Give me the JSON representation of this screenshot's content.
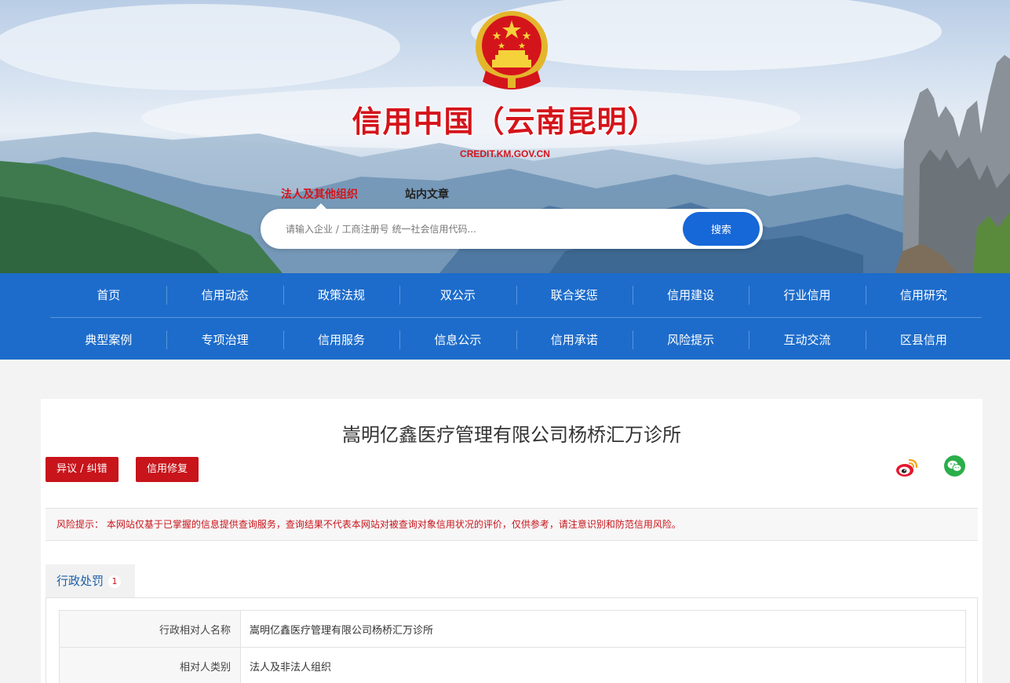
{
  "header": {
    "site_title": "信用中国（云南昆明）",
    "site_domain": "CREDIT.KM.GOV.CN",
    "search_tabs": [
      {
        "label": "法人及其他组织",
        "active": true
      },
      {
        "label": "站内文章",
        "active": false
      }
    ],
    "search_placeholder": "请输入企业 / 工商注册号 统一社会信用代码...",
    "search_button": "搜索"
  },
  "nav": {
    "row1": [
      "首页",
      "信用动态",
      "政策法规",
      "双公示",
      "联合奖惩",
      "信用建设",
      "行业信用",
      "信用研究"
    ],
    "row2": [
      "典型案例",
      "专项治理",
      "信用服务",
      "信息公示",
      "信用承诺",
      "风险提示",
      "互动交流",
      "区县信用"
    ]
  },
  "main": {
    "company_name": "嵩明亿鑫医疗管理有限公司杨桥汇万诊所",
    "buttons": {
      "objection": "异议 / 纠错",
      "repair": "信用修复"
    },
    "share_icons": [
      "weibo-icon",
      "wechat-icon"
    ],
    "risk_notice": "风险提示： 本网站仅基于已掌握的信息提供查询服务，查询结果不代表本网站对被查询对象信用状况的评价，仅供参考，请注意识别和防范信用风险。",
    "tab": {
      "label": "行政处罚",
      "count": "1"
    },
    "rows": [
      {
        "label": "行政相对人名称",
        "value": "嵩明亿鑫医疗管理有限公司杨桥汇万诊所"
      },
      {
        "label": "相对人类别",
        "value": "法人及非法人组织"
      }
    ]
  },
  "colors": {
    "brand_red": "#d4141b",
    "nav_blue": "#1d6ccb",
    "search_blue": "#1667d8"
  }
}
